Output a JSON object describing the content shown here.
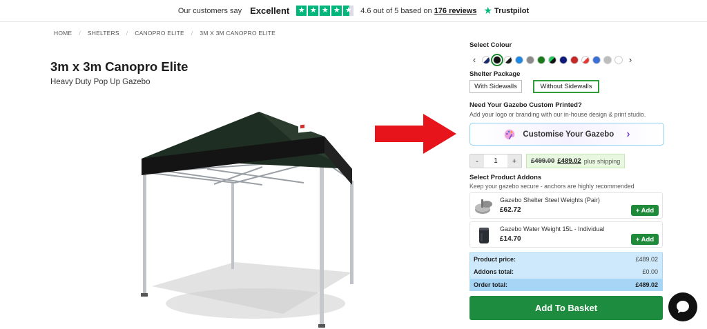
{
  "trustpilot": {
    "intro": "Our customers say",
    "rating_word": "Excellent",
    "score_text_pre": "4.6 out of 5 based on",
    "reviews_link": "176 reviews",
    "brand": "Trustpilot",
    "stars": 4.6
  },
  "breadcrumb": [
    "HOME",
    "SHELTERS",
    "CANOPRO ELITE",
    "3M X 3M CANOPRO ELITE"
  ],
  "product": {
    "title": "3m x 3m Canopro Elite",
    "subtitle": "Heavy Duty Pop Up Gazebo"
  },
  "colour": {
    "label": "Select Colour",
    "swatches": [
      "#1b2a6b",
      "#111111",
      "#1a1a1a",
      "#1e88e5",
      "#8a8a8a",
      "#1a7a1a",
      "#22c55e",
      "#0d1a7a",
      "#c62828",
      "#e53935",
      "#3b6fd8",
      "#bdbdbd",
      "#ffffff"
    ],
    "selected_index": 1
  },
  "package": {
    "label": "Shelter Package",
    "options": [
      "With Sidewalls",
      "Without Sidewalls"
    ],
    "selected": "Without Sidewalls"
  },
  "printing": {
    "heading": "Need Your Gazebo Custom Printed?",
    "subtext": "Add your logo or branding with our in-house design & print studio.",
    "button": "Customise Your Gazebo"
  },
  "quantity": {
    "minus": "-",
    "value": "1",
    "plus": "+"
  },
  "price": {
    "old": "£499.00",
    "new": "£489.02",
    "shipping": "plus shipping"
  },
  "addons": {
    "heading": "Select Product Addons",
    "subtext": "Keep your gazebo secure - anchors are highly recommended",
    "items": [
      {
        "name": "Gazebo Shelter Steel Weights (Pair)",
        "price": "£62.72",
        "button": "+ Add"
      },
      {
        "name": "Gazebo Water Weight 15L - Individual",
        "price": "£14.70",
        "button": "+ Add"
      }
    ]
  },
  "summary": {
    "product_label": "Product price:",
    "product_value": "£489.02",
    "addons_label": "Addons total:",
    "addons_value": "£0.00",
    "order_label": "Order total:",
    "order_value": "£489.02"
  },
  "basket_button": "Add To Basket",
  "colors": {
    "accent_green": "#1e8c3e",
    "trustpilot_green": "#00b67a",
    "arrow_red": "#e8141b"
  }
}
